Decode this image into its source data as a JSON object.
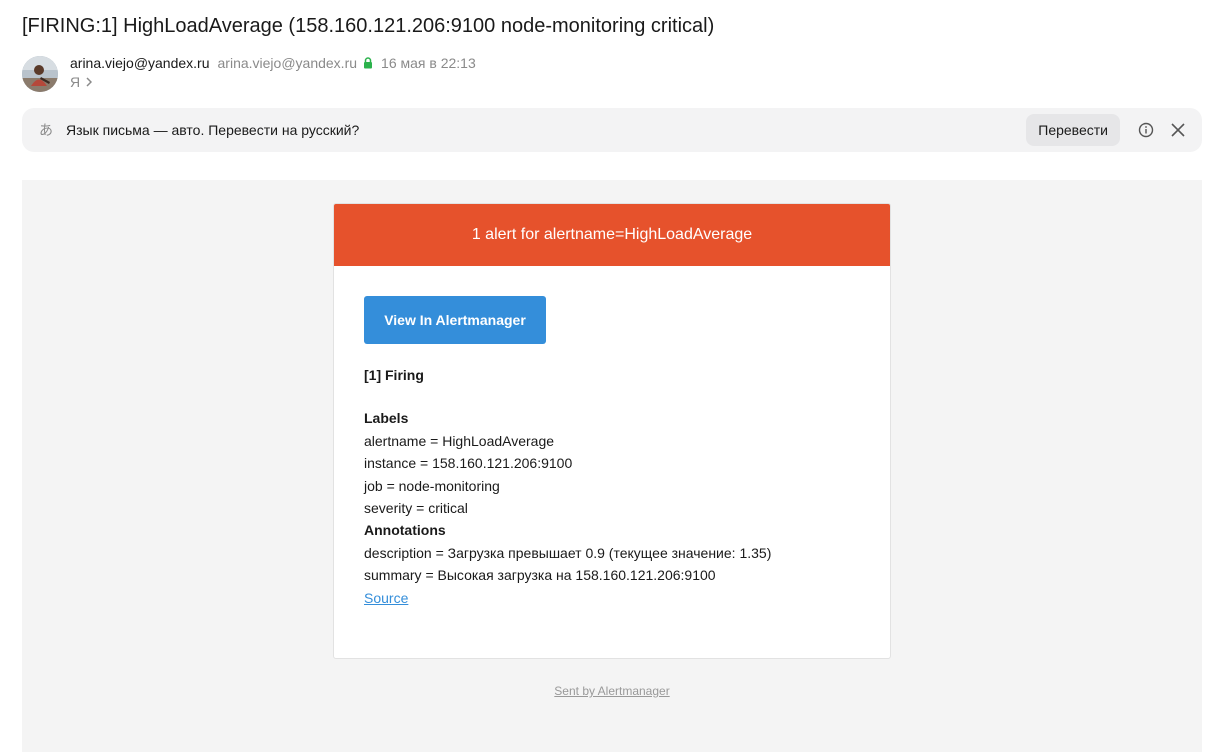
{
  "subject": "[FIRING:1] HighLoadAverage (158.160.121.206:9100 node-monitoring critical)",
  "sender": {
    "name": "arina.viejo@yandex.ru",
    "email": "arina.viejo@yandex.ru",
    "date": "16 мая в 22:13",
    "to": "Я",
    "verified_color": "#2bb24c"
  },
  "translate_bar": {
    "icon": "translate-icon",
    "text": "Язык письма — авто. Перевести на русский?",
    "button": "Перевести"
  },
  "email": {
    "header": "1 alert for alertname=HighLoadAverage",
    "header_color": "#e6522c",
    "button": "View In Alertmanager",
    "button_color": "#348eda",
    "firing": "[1] Firing",
    "labels_title": "Labels",
    "labels": [
      "alertname = HighLoadAverage",
      "instance = 158.160.121.206:9100",
      "job = node-monitoring",
      "severity = critical"
    ],
    "annotations_title": "Annotations",
    "annotations": [
      "description = Загрузка превышает 0.9 (текущее значение: 1.35)",
      "summary = Высокая загрузка на 158.160.121.206:9100"
    ],
    "source": "Source",
    "footer": "Sent by Alertmanager"
  }
}
